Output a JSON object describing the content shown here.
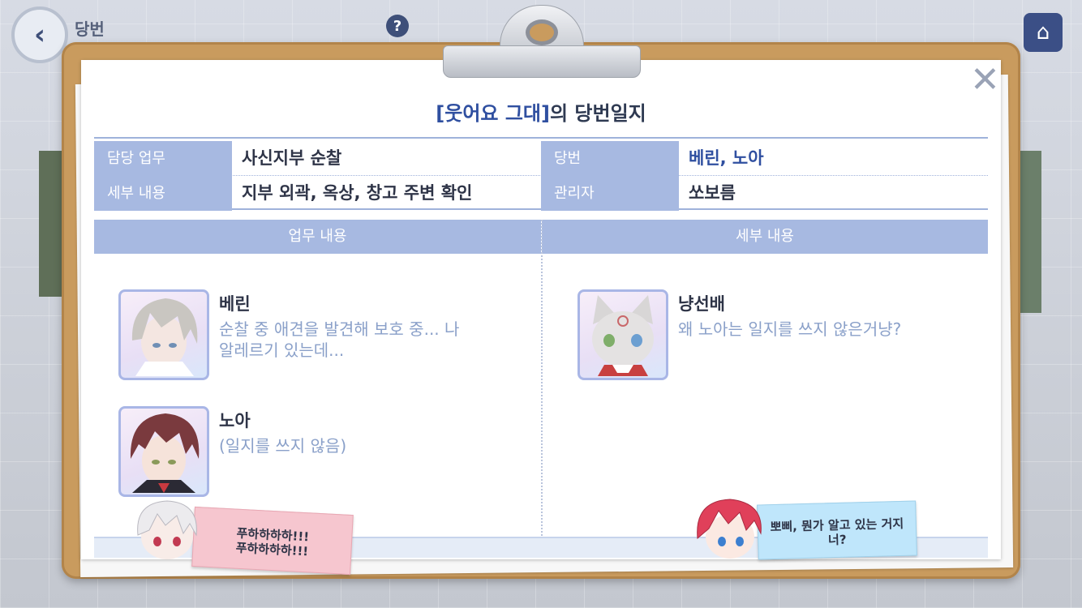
{
  "background": {
    "back_icon": "back-arrow-icon",
    "screen_title": "당번",
    "help_icon": "question-icon",
    "help_symbol": "?",
    "home_icon": "home-icon"
  },
  "dialog": {
    "title_highlight": "[웃어요 그대]",
    "title_suffix": "의 당번일지",
    "close_symbol": "✕",
    "info": {
      "task_label": "담당 업무",
      "task_value": "사신지부 순찰",
      "detail_label": "세부 내용",
      "detail_value": "지부 외곽, 옥상, 창고 주변 확인",
      "duty_label": "당번",
      "duty_value": "베린, 노아",
      "manager_label": "관리자",
      "manager_value": "쏘보름"
    },
    "sections": {
      "left_header": "업무 내용",
      "right_header": "세부 내용"
    },
    "left_entries": [
      {
        "name": "베린",
        "text": "순찰 중 애견을 발견해 보호 중... 나 알레르기 있는데..."
      },
      {
        "name": "노아",
        "text": "(일지를 쓰지 않음)"
      }
    ],
    "right_entries": [
      {
        "name": "냥선배",
        "text": "왜 노아는 일지를 쓰지 않은거냥?"
      }
    ],
    "notes": {
      "pink_line1": "푸하하하하!!!",
      "pink_line2": "푸하하하하!!!",
      "blue_line1": "뽀삐, 뭔가 알고 있는 거지",
      "blue_line2": "너?"
    }
  },
  "colors": {
    "accent": "#2f4fa0",
    "header_bg": "#a7b9e1",
    "board": "#c99b5e",
    "muted_text": "#8aa0c9"
  }
}
